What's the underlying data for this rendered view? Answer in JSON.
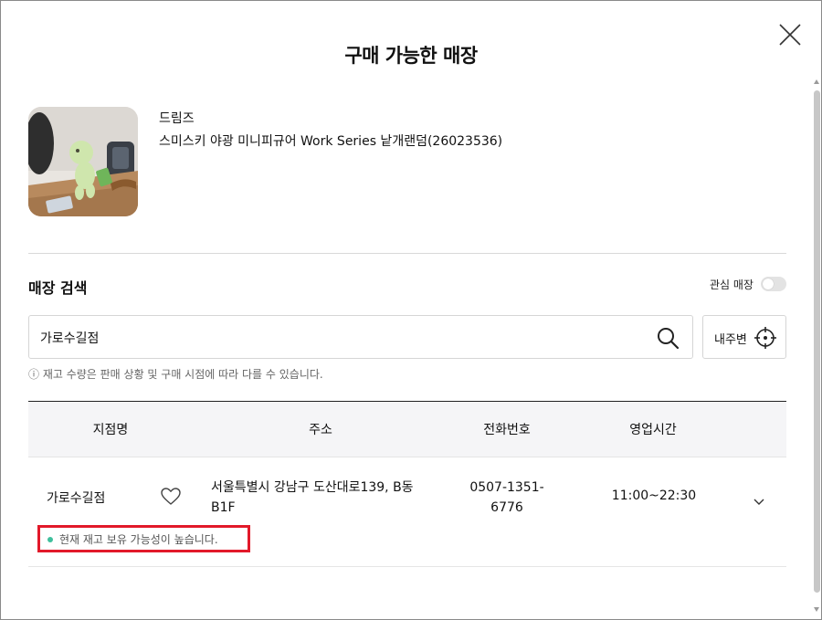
{
  "modal": {
    "title": "구매 가능한 매장"
  },
  "product": {
    "brand": "드림즈",
    "name": "스미스키 야광 미니피규어 Work Series 낱개랜덤(26023536)"
  },
  "search": {
    "section_title": "매장 검색",
    "favorite_label": "관심 매장",
    "favorite_on": false,
    "query": "가로수길점",
    "nearby_label": "내주변",
    "notice": "ⓘ 재고 수량은 판매 상황 및 구매 시점에 따라 다를 수 있습니다."
  },
  "table": {
    "headers": {
      "branch": "지점명",
      "address": "주소",
      "phone": "전화번호",
      "hours": "영업시간"
    },
    "rows": [
      {
        "branch": "가로수길점",
        "address": "서울특별시 강남구 도산대로139, B동 B1F",
        "phone": "0507-1351-6776",
        "hours": "11:00~22:30",
        "stock_status": "현재 재고 보유 가능성이 높습니다."
      }
    ]
  },
  "icons": [
    "close-icon",
    "search-icon",
    "crosshair-icon",
    "heart-icon",
    "chevron-down-icon"
  ],
  "colors": {
    "highlight": "#e2192a",
    "stock_dot": "#3fbf9c",
    "header_bg": "#f5f5f7"
  }
}
